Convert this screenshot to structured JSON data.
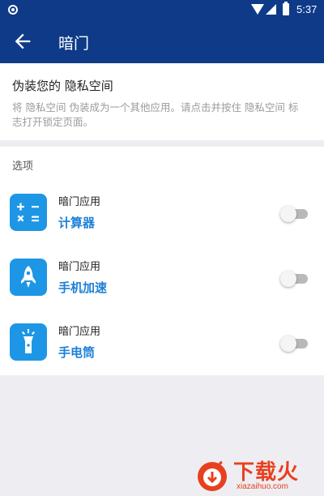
{
  "status_bar": {
    "time": "5:37"
  },
  "app_bar": {
    "title": "暗门",
    "back_icon": "arrow-left-icon"
  },
  "disguise": {
    "title": "伪装您的 隐私空间",
    "description": "将 隐私空间 伪装成为一个其他应用。请点击并按住 隐私空间 标志打开锁定页面。"
  },
  "options": {
    "section_label": "选项",
    "items": [
      {
        "label": "暗门应用",
        "app": "计算器",
        "icon": "calculator-icon",
        "enabled": false
      },
      {
        "label": "暗门应用",
        "app": "手机加速",
        "icon": "rocket-icon",
        "enabled": false
      },
      {
        "label": "暗门应用",
        "app": "手电筒",
        "icon": "flashlight-icon",
        "enabled": false
      }
    ]
  },
  "colors": {
    "primary": "#0e3a88",
    "accent": "#1e96e6",
    "link": "#1e80d8"
  },
  "watermark": {
    "name": "下载火",
    "url": "xiazaihuo.com"
  }
}
